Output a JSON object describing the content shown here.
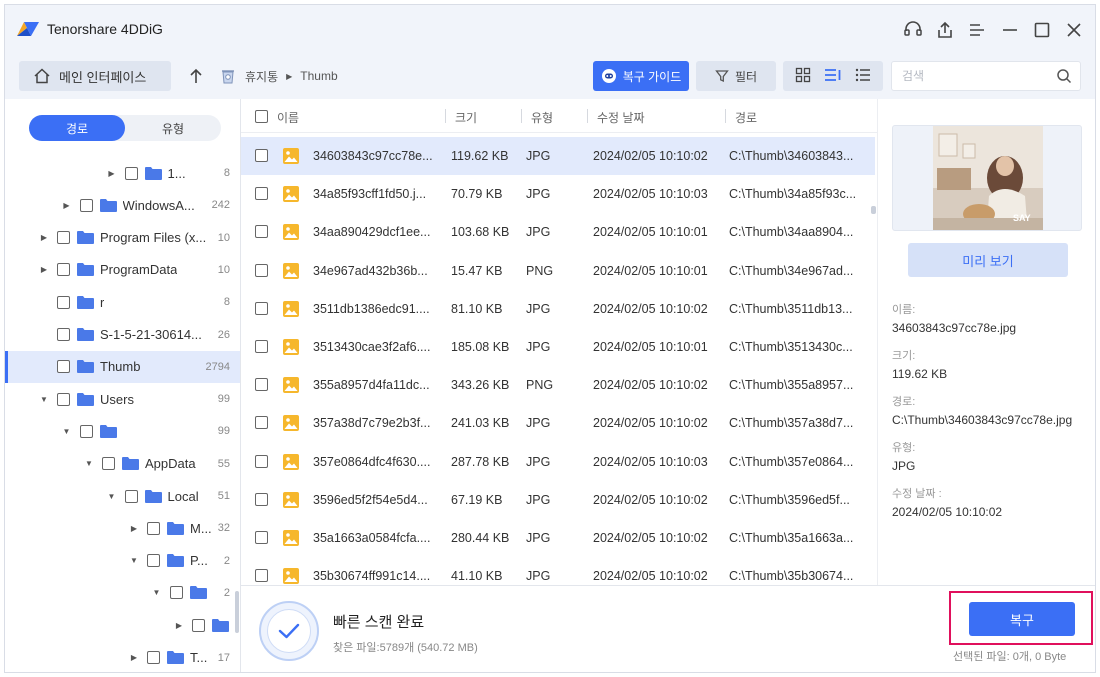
{
  "app": {
    "title": "Tenorshare 4DDiG"
  },
  "toolbar": {
    "home_label": "메인 인터페이스",
    "breadcrumb": [
      "휴지통",
      "Thumb"
    ],
    "guide_label": "복구 가이드",
    "filter_label": "필터",
    "search_placeholder": "검색"
  },
  "sidebar": {
    "tabs": [
      "경로",
      "유형"
    ],
    "active_tab": "경로",
    "items": [
      {
        "name": "1...",
        "count": "8",
        "indent": 5,
        "arrow": "right"
      },
      {
        "name": "WindowsA...",
        "count": "242",
        "indent": 3,
        "arrow": "right"
      },
      {
        "name": "Program Files (x...",
        "count": "10",
        "indent": 2,
        "arrow": "right"
      },
      {
        "name": "ProgramData",
        "count": "10",
        "indent": 2,
        "arrow": "right"
      },
      {
        "name": "r",
        "count": "8",
        "indent": 2,
        "arrow": ""
      },
      {
        "name": "S-1-5-21-30614...",
        "count": "26",
        "indent": 2,
        "arrow": ""
      },
      {
        "name": "Thumb",
        "count": "2794",
        "indent": 2,
        "arrow": "",
        "selected": true
      },
      {
        "name": "Users",
        "count": "99",
        "indent": 2,
        "arrow": "down"
      },
      {
        "name": "",
        "count": "99",
        "indent": 3,
        "arrow": "down"
      },
      {
        "name": "AppData",
        "count": "55",
        "indent": 4,
        "arrow": "down"
      },
      {
        "name": "Local",
        "count": "51",
        "indent": 5,
        "arrow": "down"
      },
      {
        "name": "M...",
        "count": "32",
        "indent": 6,
        "arrow": "right"
      },
      {
        "name": "P...",
        "count": "2",
        "indent": 6,
        "arrow": "down"
      },
      {
        "name": "",
        "count": "2",
        "indent": 7,
        "arrow": "down"
      },
      {
        "name": "",
        "count": "",
        "indent": 8,
        "arrow": "right"
      },
      {
        "name": "T...",
        "count": "17",
        "indent": 6,
        "arrow": "right"
      }
    ]
  },
  "list": {
    "headers": {
      "name": "이름",
      "size": "크기",
      "type": "유형",
      "date": "수정 날짜",
      "path": "경로"
    },
    "rows": [
      {
        "name": "34603843c97cc78e...",
        "size": "119.62 KB",
        "type": "JPG",
        "date": "2024/02/05 10:10:02",
        "path": "C:\\Thumb\\34603843...",
        "selected": true
      },
      {
        "name": "34a85f93cff1fd50.j...",
        "size": "70.79 KB",
        "type": "JPG",
        "date": "2024/02/05 10:10:03",
        "path": "C:\\Thumb\\34a85f93c..."
      },
      {
        "name": "34aa890429dcf1ee...",
        "size": "103.68 KB",
        "type": "JPG",
        "date": "2024/02/05 10:10:01",
        "path": "C:\\Thumb\\34aa8904..."
      },
      {
        "name": "34e967ad432b36b...",
        "size": "15.47 KB",
        "type": "PNG",
        "date": "2024/02/05 10:10:01",
        "path": "C:\\Thumb\\34e967ad..."
      },
      {
        "name": "3511db1386edc91....",
        "size": "81.10 KB",
        "type": "JPG",
        "date": "2024/02/05 10:10:02",
        "path": "C:\\Thumb\\3511db13..."
      },
      {
        "name": "3513430cae3f2af6....",
        "size": "185.08 KB",
        "type": "JPG",
        "date": "2024/02/05 10:10:01",
        "path": "C:\\Thumb\\3513430c..."
      },
      {
        "name": "355a8957d4fa11dc...",
        "size": "343.26 KB",
        "type": "PNG",
        "date": "2024/02/05 10:10:02",
        "path": "C:\\Thumb\\355a8957..."
      },
      {
        "name": "357a38d7c79e2b3f...",
        "size": "241.03 KB",
        "type": "JPG",
        "date": "2024/02/05 10:10:02",
        "path": "C:\\Thumb\\357a38d7..."
      },
      {
        "name": "357e0864dfc4f630....",
        "size": "287.78 KB",
        "type": "JPG",
        "date": "2024/02/05 10:10:03",
        "path": "C:\\Thumb\\357e0864..."
      },
      {
        "name": "3596ed5f2f54e5d4...",
        "size": "67.19 KB",
        "type": "JPG",
        "date": "2024/02/05 10:10:02",
        "path": "C:\\Thumb\\3596ed5f..."
      },
      {
        "name": "35a1663a0584fcfa....",
        "size": "280.44 KB",
        "type": "JPG",
        "date": "2024/02/05 10:10:02",
        "path": "C:\\Thumb\\35a1663a..."
      },
      {
        "name": "35b30674ff991c14....",
        "size": "41.10 KB",
        "type": "JPG",
        "date": "2024/02/05 10:10:02",
        "path": "C:\\Thumb\\35b30674..."
      }
    ]
  },
  "preview": {
    "button_label": "미리 보기",
    "thumb_text": "SAY",
    "meta": [
      {
        "label": "이름:",
        "value": "34603843c97cc78e.jpg"
      },
      {
        "label": "크기:",
        "value": "119.62 KB"
      },
      {
        "label": "경로:",
        "value": "C:\\Thumb\\34603843c97cc78e.jpg"
      },
      {
        "label": "유형:",
        "value": "JPG"
      },
      {
        "label": "수정 날짜 :",
        "value": "2024/02/05 10:10:02"
      }
    ]
  },
  "status": {
    "title": "빠른 스캔 완료",
    "found": "찾은 파일:5789개 (540.72 MB)",
    "recover_label": "복구",
    "selected_info": "선택된 파일: 0개, 0 Byte"
  },
  "colors": {
    "accent": "#3b6ff5",
    "highlight": "#e0105c",
    "selected_row": "#e2eafc",
    "folder": "#4a79e8",
    "image_icon": "#f6b72c"
  }
}
